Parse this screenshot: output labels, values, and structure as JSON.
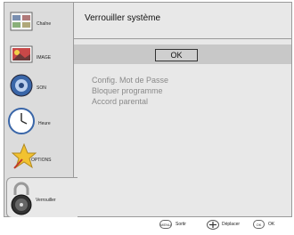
{
  "sidebar": {
    "items": [
      {
        "label": "Chaîne",
        "icon": "channel-list-icon"
      },
      {
        "label": "IMAGE",
        "icon": "picture-icon"
      },
      {
        "label": "SON",
        "icon": "speaker-icon"
      },
      {
        "label": "Heure",
        "icon": "clock-icon"
      },
      {
        "label": "OPTIONS",
        "icon": "star-icon"
      },
      {
        "label": "Verrouiller",
        "icon": "padlock-icon"
      }
    ],
    "active_index": 5
  },
  "main": {
    "title": "Verrouiller système",
    "ok_label": "OK",
    "items": [
      "Config. Mot de Passe",
      "Bloquer programme",
      "Accord parental"
    ]
  },
  "footer": {
    "menu_key": "MENU",
    "menu_label": "Sortir",
    "move_label": "Déplacer",
    "ok_key": "OK",
    "ok_label": "OK"
  },
  "colors": {
    "panel": "#e8e8e8",
    "sidebar": "#dcdcdc",
    "ok_strip": "#c8c8c8",
    "disabled_text": "#8a8a8a"
  }
}
